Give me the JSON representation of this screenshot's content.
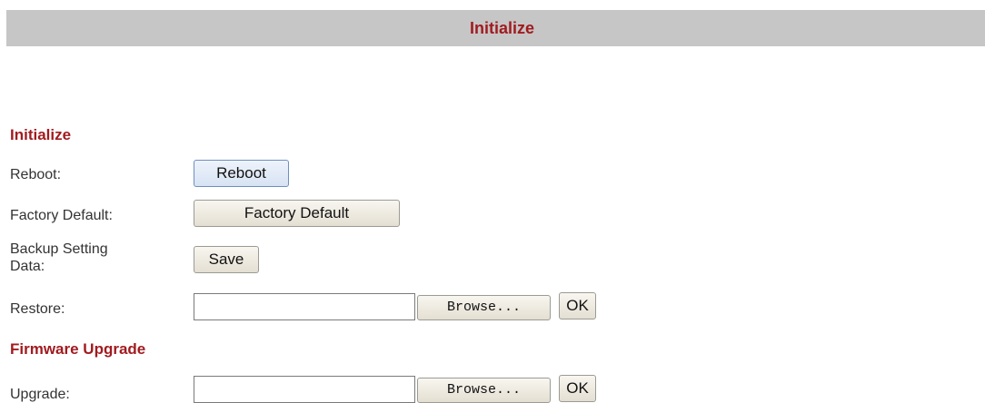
{
  "header": {
    "title": "Initialize"
  },
  "initialize": {
    "section_title": "Initialize",
    "reboot_label": "Reboot:",
    "reboot_button": "Reboot",
    "factory_default_label": "Factory Default:",
    "factory_default_button": "Factory Default",
    "backup_label_line1": "Backup Setting",
    "backup_label_line2": "Data:",
    "save_button": "Save",
    "restore_label": "Restore:",
    "restore_file_value": "",
    "restore_browse_button": "Browse...",
    "restore_ok_button": "OK"
  },
  "firmware": {
    "section_title": "Firmware Upgrade",
    "upgrade_label": "Upgrade:",
    "upgrade_file_value": "",
    "upgrade_browse_button": "Browse...",
    "upgrade_ok_button": "OK"
  },
  "colors": {
    "title_bar_bg": "#c6c6c6",
    "accent_red": "#a11b1f"
  }
}
